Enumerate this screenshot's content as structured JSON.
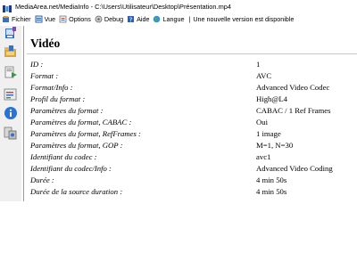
{
  "window": {
    "title": "MediaArea.net/MediaInfo - C:\\Users\\Utilisateur\\Desktop\\Présentation.mp4"
  },
  "menu": {
    "items": [
      {
        "label": "Fichier",
        "icon": "file-icon"
      },
      {
        "label": "Vue",
        "icon": "view-icon"
      },
      {
        "label": "Options",
        "icon": "options-icon"
      },
      {
        "label": "Debug",
        "icon": "debug-icon"
      },
      {
        "label": "Aide",
        "icon": "help-icon"
      },
      {
        "label": "Langue",
        "icon": "language-icon"
      }
    ],
    "notice": "Une nouvelle version est disponible"
  },
  "sidebar": {
    "buttons": [
      "open-file-icon",
      "open-folder-icon",
      "export-icon",
      "options-icon",
      "info-icon",
      "properties-icon"
    ]
  },
  "section": {
    "title": "Vidéo",
    "rows": [
      {
        "label": "ID :",
        "value": "1"
      },
      {
        "label": "Format :",
        "value": "AVC"
      },
      {
        "label": "Format/Info :",
        "value": "Advanced Video Codec"
      },
      {
        "label": "Profil du format :",
        "value": "High@L4"
      },
      {
        "label": "Paramètres du format :",
        "value": "CABAC / 1 Ref Frames"
      },
      {
        "label": "Paramètres du format, CABAC :",
        "value": "Oui"
      },
      {
        "label": "Paramètres du format, RefFrames :",
        "value": "1 image"
      },
      {
        "label": "Paramètres du format, GOP :",
        "value": "M=1, N=30"
      },
      {
        "label": "Identifiant du codec :",
        "value": "avc1"
      },
      {
        "label": "Identifiant du codec/Info :",
        "value": "Advanced Video Coding"
      },
      {
        "label": "Durée :",
        "value": "4 min 50s"
      },
      {
        "label": "Durée de la source duration :",
        "value": "4 min 50s"
      }
    ]
  }
}
